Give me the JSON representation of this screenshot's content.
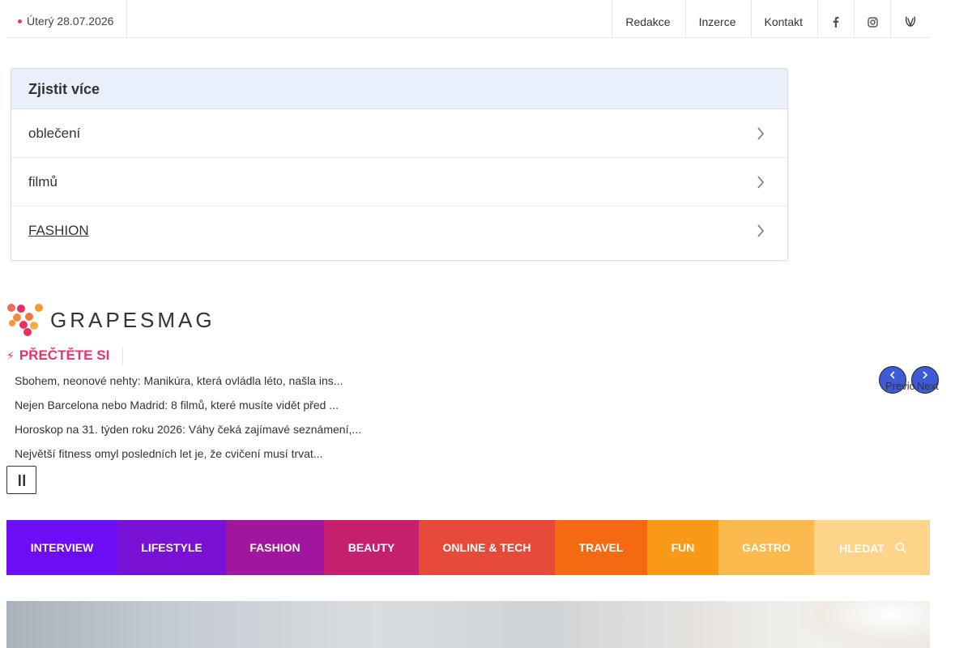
{
  "topbar": {
    "date": "Úterý 28.07.2026",
    "links": [
      "Redakce",
      "Inzerce",
      "Kontakt"
    ],
    "icons": [
      "facebook-icon",
      "instagram-icon",
      "account-icon"
    ]
  },
  "more": {
    "title": "Zjistit více",
    "items": [
      {
        "label": "oblečení"
      },
      {
        "label": "filmů"
      },
      {
        "label": "FASHION"
      }
    ]
  },
  "logo": {
    "text": "GRAPESMAG"
  },
  "read": {
    "title": "PŘEČTĚTE SI",
    "items": [
      "Sbohem, neonové nehty: Manikúra, která ovládla léto, našla ins...",
      "Nejen Barcelona nebo Madrid: 8 filmů, které musíte vidět před ...",
      "Horoskop na 31. týden roku 2026: Váhy čeká zajímavé seznámení,...",
      "Největší fitness omyl posledních let je, že cvičení musí trvat..."
    ],
    "prev_label": "Previo",
    "next_label": "Next"
  },
  "nav": {
    "items": [
      {
        "label": "INTERVIEW",
        "color": "#6c0df5"
      },
      {
        "label": "LIFESTYLE",
        "color": "#7a12d6"
      },
      {
        "label": "FASHION",
        "color": "#a0169c"
      },
      {
        "label": "BEAUTY",
        "color": "#c4206d"
      },
      {
        "label": "ONLINE & TECH",
        "color": "#e84a3a"
      },
      {
        "label": "TRAVEL",
        "color": "#f36a13"
      },
      {
        "label": "FUN",
        "color": "#f99a17"
      },
      {
        "label": "GASTRO",
        "color": "#fbb94e"
      },
      {
        "label": "HLEDAT",
        "color": "#fdd489"
      }
    ]
  },
  "colors": {
    "accent": "#e8336b",
    "nav_button": "#3d5bd6"
  }
}
